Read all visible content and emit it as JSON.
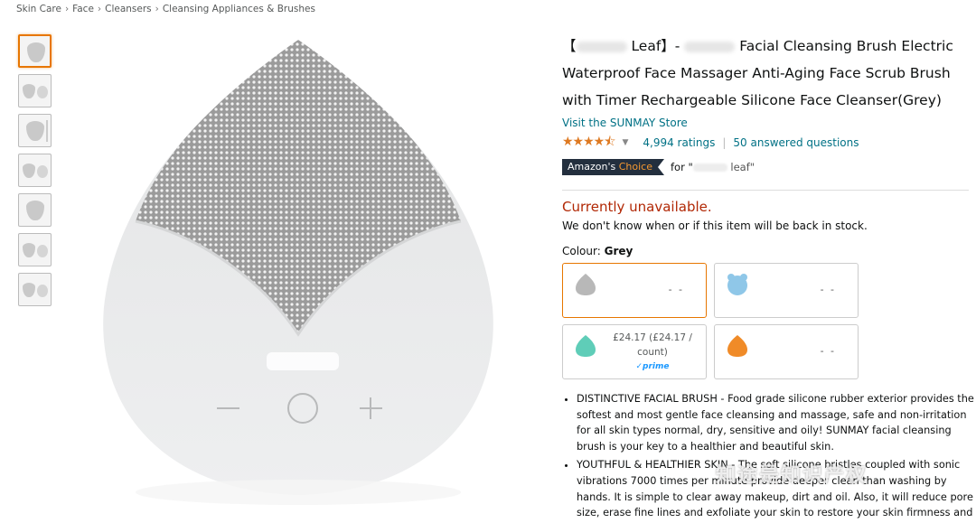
{
  "breadcrumb": [
    "Skin Care",
    "Face",
    "Cleansers",
    "Cleansing Appliances & Brushes"
  ],
  "product": {
    "title_prefix": "【",
    "title_leaf": " Leaf】- ",
    "title_rest": " Facial Cleansing Brush Electric Waterproof Face Massager Anti-Aging Face Scrub Brush with Timer Rechargeable Silicone Face Cleanser(Grey)",
    "store_link": "Visit the SUNMAY Store",
    "rating_stars": "★★★★⯪",
    "ratings_count": "4,994 ratings",
    "answered_questions": "50 answered questions",
    "choice_badge_part1": "Amazon's",
    "choice_badge_part2": "Choice",
    "choice_for_prefix": "for \"",
    "choice_for_keyword": " leaf\""
  },
  "availability": {
    "status": "Currently unavailable.",
    "detail": "We don't know when or if this item will be back in stock."
  },
  "colour": {
    "label": "Colour:",
    "selected": "Grey",
    "options": [
      {
        "name": "grey",
        "color": "#b8b8b8",
        "price": "- -"
      },
      {
        "name": "blue",
        "color": "#8fc7e8",
        "price": "- -"
      },
      {
        "name": "teal",
        "color": "#5fcdb8",
        "price_line1": "£24.17 (£24.17 /",
        "price_line2": "count)",
        "prime": "✓prime"
      },
      {
        "name": "orange",
        "color": "#f08b28",
        "price": "- -"
      }
    ]
  },
  "features": [
    "DISTINCTIVE FACIAL BRUSH - Food grade silicone rubber exterior provides the softest and most gentle face cleansing and massage, safe and non-irritation for all skin types normal, dry, sensitive and oily! SUNMAY facial cleansing brush is your key to a healthier and beautiful skin.",
    "YOUTHFUL & HEALTHIER SKIN - The soft silicone bristles coupled with sonic vibrations 7000 times per minute provide deeper clean than washing by hands. It is simple to clear away makeup, dirt and oil. Also, it will reduce pore size, erase fine lines and exfoliate your skin to restore your skin firmness and elasticity."
  ],
  "watermark": "知途是知识产权",
  "colors": {
    "link": "#007185",
    "unavailable": "#b12704",
    "star": "#de7921",
    "selected_border": "#e77600"
  }
}
